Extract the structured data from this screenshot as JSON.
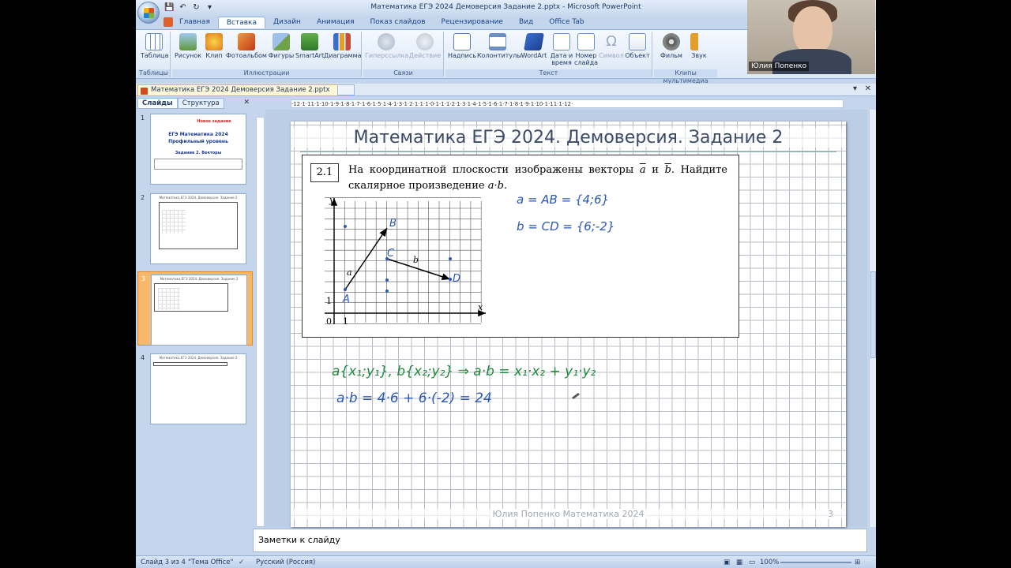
{
  "window": {
    "title": "Математика ЕГЭ 2024 Демоверсия Задание 2.pptx - Microsoft PowerPoint"
  },
  "ribbon_tabs": [
    "Главная",
    "Вставка",
    "Дизайн",
    "Анимация",
    "Показ слайдов",
    "Рецензирование",
    "Вид",
    "Office Tab"
  ],
  "ribbon_groups": {
    "tables": "Таблицы",
    "illustrations": "Иллюстрации",
    "links": "Связи",
    "text": "Текст",
    "media": "Клипы мультимедиа"
  },
  "ribbon_buttons": {
    "table": "Таблица",
    "picture": "Рисунок",
    "clip": "Клип",
    "album": "Фотоальбом",
    "shapes": "Фигуры",
    "smartart": "SmartArt",
    "chart": "Диаграмма",
    "hyperlink": "Гиперссылка",
    "action": "Действие",
    "textbox": "Надпись",
    "headerfooter": "Колонтитулы",
    "wordart": "WordArt",
    "datetime_1": "Дата и",
    "datetime_2": "время",
    "slidenum_1": "Номер",
    "slidenum_2": "слайда",
    "symbol": "Символ",
    "object": "Объект",
    "movie": "Фильм",
    "sound": "Звук"
  },
  "doc_tab": {
    "label": "Математика ЕГЭ 2024 Демоверсия Задание 2.pptx"
  },
  "left_pane": {
    "tab_slides": "Слайды",
    "tab_outline": "Структура",
    "thumbs": [
      {
        "num": "1",
        "title": "Новое задание",
        "line1": "ЕГЭ Математика 2024",
        "line2": "Профильный уровень",
        "line3": "Задание 2. Векторы"
      },
      {
        "num": "2",
        "title": "Математика ЕГЭ 2024. Демоверсия. Задание 2"
      },
      {
        "num": "3",
        "title": "Математика ЕГЭ 2024. Демоверсия. Задание 2"
      },
      {
        "num": "4",
        "title": "Математика ЕГЭ 2024. Демоверсия. Задание 2"
      }
    ]
  },
  "ruler": {
    "marks": "·12·1·11·1·10·1·9·1·8·1·7·1·6·1·5·1·4·1·3·1·2·1·1·1·0·1·1·1·2·1·3·1·4·1·5·1·6·1·7·1·8·1·9·1·10·1·11·1·12·"
  },
  "slide": {
    "title": "Математика ЕГЭ 2024. Демоверсия. Задание 2",
    "task_number": "2.1",
    "task_text_1": "На координатной плоскости изображены векторы",
    "task_vec_a": "a",
    "task_and": "и",
    "task_vec_b": "b",
    "task_text_2": ". Найдите скалярное произведение",
    "task_dot": "a·b.",
    "graph": {
      "y_label": "y",
      "x_label": "x",
      "origin": "0",
      "one_x": "1",
      "one_y": "1",
      "A": "A",
      "B": "B",
      "C": "C",
      "D": "D",
      "vec_a": "a",
      "vec_b": "b"
    },
    "handwriting": {
      "line1": "a = AB = {4;6}",
      "line2": "b = CD = {6;-2}",
      "line3": "a{x₁;y₁}, b{x₂;y₂}  ⇒  a·b = x₁·x₂ + y₁·y₂",
      "line4": "a·b = 4·6 + 6·(-2) = 24"
    },
    "footer": "Юлия Попенко Математика 2024",
    "number": "3"
  },
  "notes": {
    "placeholder": "Заметки к слайду"
  },
  "status": {
    "slide": "Слайд 3 из 4",
    "theme": "\"Тема Office\"",
    "lang": "Русский (Россия)",
    "zoom": "100%"
  },
  "webcam": {
    "name": "Юлия Попенко"
  },
  "colors": {
    "accent": "#15428b",
    "ink_blue": "#2a58b8",
    "ink_green": "#1e8a3c"
  }
}
